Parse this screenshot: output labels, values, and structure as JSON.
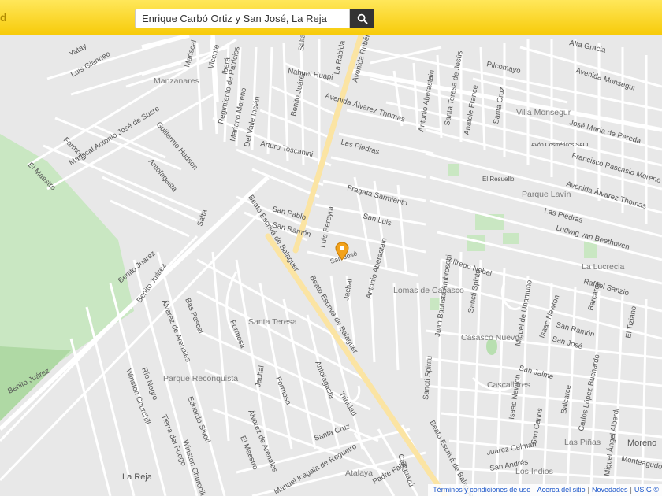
{
  "header": {
    "brand_fragment": "d",
    "search": {
      "value": "Enrique Carbó Ortiz y San José, La Reja",
      "placeholder": ""
    }
  },
  "map": {
    "colors": {
      "background": "#e8e8e8",
      "street": "#ffffff",
      "avenue": "#fbe4a3",
      "park": "#c9e7c2",
      "pin": "#f2a21b"
    },
    "streets": [
      "Yatay",
      "Luis Gianneo",
      "Mariscal",
      "Vicente",
      "Iberá",
      "Salta",
      "La Rábida",
      "Avenida Rubén",
      "Nahuel Huapi",
      "Regimiento de Patricios",
      "Mariano Moreno",
      "Del Valle Inclán",
      "Benito Juárez",
      "Avenida Álvarez Thomas",
      "Antonio Aberastain",
      "Santa Teresa de Jesús",
      "Anatole France",
      "Santa Cruz",
      "Alta Gracia",
      "Pilcomayo",
      "Avenida Monsegur",
      "Villa Monsegur",
      "José María de Pereda",
      "Francisco Pascasio Moreno",
      "Avenida Álvarez Thomas",
      "El Resuello",
      "Guillermo Hudson",
      "Mariscal Antonio José de Sucre",
      "Formosa",
      "Antofagasta",
      "Arturo Toscanini",
      "Las Piedras",
      "Fragata Sarmiento",
      "El Maestro",
      "San Pablo",
      "San Ramón",
      "Luis Pereyra",
      "San Luis",
      "Salta",
      "Beato Escrivá de Balaguer",
      "Las Piedras",
      "Ludwig van Beethoven",
      "San José",
      "Antonio Aberastain",
      "Alfredo Nobel",
      "Benito Juárez",
      "Beato Escrivá de Balaguer",
      "Jachal",
      "Juan Bautista Ambrosetti",
      "Sancti Spiritu",
      "Miguel de Unamuno",
      "Isaac Newton",
      "San Ramón",
      "San José",
      "Barcarce",
      "El Tiziano",
      "Rafael Sanzio",
      "Bas Pascal",
      "Álvarez de Arenales",
      "Formosa",
      "Benito Juárez",
      "Winston Churchill",
      "Río Negro",
      "Eduardo Sívori",
      "Tierra del Fuego",
      "Jachal",
      "Formosa",
      "Antofagasta",
      "Trinidad",
      "Santa Cruz",
      "Álvarez de Arenales",
      "El Maestro",
      "Winston Churchill",
      "Beato Escrivá de Balaguer",
      "Sancti Spiritu",
      "San Jaime",
      "Isaac Newton",
      "San Carlos",
      "Balcarce",
      "Carlos López Buchardo",
      "Juárez Celman",
      "San Andrés",
      "Miguel Ángel Alberdi",
      "Monteagudo",
      "Caaguazú",
      "Padre Fahy",
      "Manuel Icagaia de Regueiro",
      "Benito Juárez"
    ],
    "areas": [
      "Manzanares",
      "Lomas de Casasco",
      "Parque Lavín",
      "La Lucrecia",
      "Santa Teresa",
      "Casasco Nuevo",
      "Parque Reconquista",
      "Cascallares",
      "Las Piñas",
      "Moreno",
      "La Reja",
      "Atalaya",
      "Los Indios"
    ],
    "poi": "Avón Cosméticos SACI",
    "pin": {
      "label": "San José"
    }
  },
  "footer": {
    "links": [
      "Términos y condiciones de uso",
      "Acerca del sitio",
      "Novedades",
      "USIG ©"
    ]
  }
}
